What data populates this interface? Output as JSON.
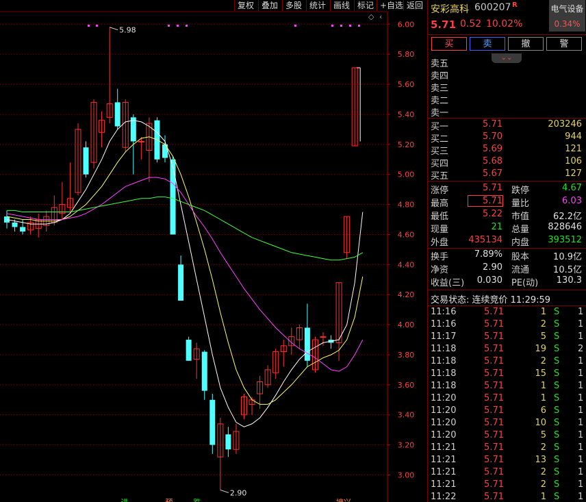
{
  "toolbar": {
    "items": [
      "复权",
      "叠加",
      "多股",
      "统计",
      "画线",
      "标记",
      "+自选",
      "返回"
    ]
  },
  "chart_data": {
    "type": "candlestick",
    "y_ticks": [
      "6.00",
      "5.80",
      "5.60",
      "5.40",
      "5.20",
      "5.00",
      "4.80",
      "4.60",
      "4.40",
      "4.20",
      "4.00",
      "3.80",
      "3.60",
      "3.40",
      "3.20",
      "3.00"
    ],
    "ylim": [
      2.95,
      6.03
    ],
    "high_label": "5.98",
    "low_label": "2.90",
    "bottom_markers": [
      "进",
      "预",
      "跌",
      "摘兴"
    ],
    "candles": [
      {
        "o": 4.72,
        "h": 4.76,
        "l": 4.64,
        "c": 4.68
      },
      {
        "o": 4.68,
        "h": 4.7,
        "l": 4.62,
        "c": 4.65
      },
      {
        "o": 4.65,
        "h": 4.7,
        "l": 4.6,
        "c": 4.62
      },
      {
        "o": 4.63,
        "h": 4.72,
        "l": 4.6,
        "c": 4.68
      },
      {
        "o": 4.64,
        "h": 4.74,
        "l": 4.58,
        "c": 4.7
      },
      {
        "o": 4.66,
        "h": 4.76,
        "l": 4.62,
        "c": 4.72
      },
      {
        "o": 4.68,
        "h": 4.86,
        "l": 4.66,
        "c": 4.78
      },
      {
        "o": 4.74,
        "h": 4.95,
        "l": 4.7,
        "c": 4.8
      },
      {
        "o": 4.78,
        "h": 5.08,
        "l": 4.74,
        "c": 4.84
      },
      {
        "o": 4.88,
        "h": 5.34,
        "l": 4.86,
        "c": 5.3
      },
      {
        "o": 5.18,
        "h": 5.22,
        "l": 4.98,
        "c": 5.0
      },
      {
        "o": 5.08,
        "h": 5.5,
        "l": 5.04,
        "c": 5.48
      },
      {
        "o": 5.28,
        "h": 5.42,
        "l": 5.18,
        "c": 5.36
      },
      {
        "o": 5.38,
        "h": 5.98,
        "l": 5.34,
        "c": 5.47
      },
      {
        "o": 5.48,
        "h": 5.57,
        "l": 5.3,
        "c": 5.32
      },
      {
        "o": 5.18,
        "h": 5.5,
        "l": 5.15,
        "c": 5.48
      },
      {
        "o": 5.38,
        "h": 5.4,
        "l": 5.0,
        "c": 5.22
      },
      {
        "o": 5.22,
        "h": 5.25,
        "l": 5.1,
        "c": 5.22
      },
      {
        "o": 5.16,
        "h": 5.38,
        "l": 4.95,
        "c": 5.34
      },
      {
        "o": 5.36,
        "h": 5.38,
        "l": 5.08,
        "c": 5.1
      },
      {
        "o": 5.2,
        "h": 5.26,
        "l": 5.08,
        "c": 5.11
      },
      {
        "o": 5.1,
        "h": 5.12,
        "l": 4.6,
        "c": 4.6
      },
      {
        "o": 4.4,
        "h": 4.46,
        "l": 4.16,
        "c": 4.16
      },
      {
        "o": 3.9,
        "h": 3.92,
        "l": 3.76,
        "c": 3.76
      },
      {
        "o": 3.77,
        "h": 3.88,
        "l": 3.64,
        "c": 3.84
      },
      {
        "o": 3.82,
        "h": 3.83,
        "l": 3.5,
        "c": 3.56
      },
      {
        "o": 3.5,
        "h": 3.54,
        "l": 3.14,
        "c": 3.2
      },
      {
        "o": 3.12,
        "h": 3.38,
        "l": 2.9,
        "c": 3.34
      },
      {
        "o": 3.27,
        "h": 3.32,
        "l": 3.12,
        "c": 3.17
      },
      {
        "o": 3.17,
        "h": 3.34,
        "l": 3.14,
        "c": 3.29
      },
      {
        "o": 3.4,
        "h": 3.54,
        "l": 3.37,
        "c": 3.52
      },
      {
        "o": 3.47,
        "h": 3.52,
        "l": 3.4,
        "c": 3.5
      },
      {
        "o": 3.54,
        "h": 3.66,
        "l": 3.44,
        "c": 3.62
      },
      {
        "o": 3.6,
        "h": 3.73,
        "l": 3.58,
        "c": 3.7
      },
      {
        "o": 3.68,
        "h": 3.84,
        "l": 3.64,
        "c": 3.82
      },
      {
        "o": 3.82,
        "h": 3.9,
        "l": 3.72,
        "c": 3.86
      },
      {
        "o": 3.86,
        "h": 3.98,
        "l": 3.8,
        "c": 3.92
      },
      {
        "o": 3.9,
        "h": 4.0,
        "l": 3.84,
        "c": 3.98
      },
      {
        "o": 3.98,
        "h": 4.14,
        "l": 3.72,
        "c": 3.76
      },
      {
        "o": 3.7,
        "h": 3.92,
        "l": 3.68,
        "c": 3.9
      },
      {
        "o": 3.92,
        "h": 3.95,
        "l": 3.86,
        "c": 3.92
      },
      {
        "o": 3.9,
        "h": 3.93,
        "l": 3.84,
        "c": 3.88
      },
      {
        "o": 3.88,
        "h": 4.28,
        "l": 3.76,
        "c": 4.28
      },
      {
        "o": 4.48,
        "h": 4.72,
        "l": 4.44,
        "c": 4.72
      },
      {
        "o": 5.19,
        "h": 5.71,
        "l": 5.19,
        "c": 5.71
      }
    ],
    "series": [
      {
        "color": "#ffffff",
        "values": [
          4.7,
          4.69,
          4.68,
          4.67,
          4.67,
          4.67,
          4.68,
          4.7,
          4.74,
          4.82,
          4.9,
          5.0,
          5.1,
          5.22,
          5.3,
          5.35,
          5.36,
          5.35,
          5.32,
          5.28,
          5.22,
          5.05,
          4.8,
          4.55,
          4.3,
          4.05,
          3.8,
          3.58,
          3.45,
          3.35,
          3.32,
          3.34,
          3.38,
          3.45,
          3.53,
          3.62,
          3.7,
          3.77,
          3.82,
          3.85,
          3.88,
          3.89,
          3.9,
          4.0,
          4.28,
          4.75
        ]
      },
      {
        "color": "#ffff60",
        "values": [
          4.72,
          4.71,
          4.7,
          4.7,
          4.69,
          4.69,
          4.69,
          4.7,
          4.72,
          4.76,
          4.8,
          4.86,
          4.92,
          5.0,
          5.08,
          5.15,
          5.2,
          5.24,
          5.25,
          5.23,
          5.2,
          5.12,
          5.0,
          4.85,
          4.68,
          4.5,
          4.3,
          4.08,
          3.88,
          3.7,
          3.58,
          3.5,
          3.47,
          3.47,
          3.5,
          3.55,
          3.6,
          3.66,
          3.72,
          3.75,
          3.78,
          3.8,
          3.83,
          3.9,
          4.05,
          4.32
        ]
      },
      {
        "color": "#ff40ff",
        "values": [
          4.74,
          4.73,
          4.72,
          4.71,
          4.7,
          4.7,
          4.7,
          4.7,
          4.71,
          4.72,
          4.74,
          4.77,
          4.8,
          4.84,
          4.88,
          4.92,
          4.94,
          4.96,
          4.98,
          4.98,
          4.97,
          4.94,
          4.88,
          4.8,
          4.72,
          4.65,
          4.57,
          4.48,
          4.4,
          4.32,
          4.24,
          4.17,
          4.1,
          4.04,
          3.98,
          3.93,
          3.88,
          3.84,
          3.81,
          3.78,
          3.74,
          3.7,
          3.69,
          3.72,
          3.8,
          3.9
        ]
      },
      {
        "color": "#40ff40",
        "values": [
          4.76,
          4.76,
          4.75,
          4.75,
          4.75,
          4.75,
          4.75,
          4.75,
          4.75,
          4.76,
          4.77,
          4.78,
          4.79,
          4.8,
          4.81,
          4.82,
          4.83,
          4.84,
          4.84,
          4.85,
          4.85,
          4.84,
          4.82,
          4.8,
          4.78,
          4.76,
          4.73,
          4.7,
          4.67,
          4.64,
          4.61,
          4.58,
          4.56,
          4.54,
          4.52,
          4.5,
          4.48,
          4.47,
          4.46,
          4.45,
          4.44,
          4.43,
          4.43,
          4.44,
          4.45,
          4.48
        ]
      }
    ]
  },
  "quote": {
    "name": "安彩高科",
    "code": "600207",
    "r_badge": "R",
    "sector": "电气设备",
    "sector_pct": "0.34%",
    "price": "5.71",
    "change": "0.52",
    "change_pct": "10.02%"
  },
  "buttons": {
    "buy": "买",
    "sell": "卖",
    "cancel": "撤",
    "alert": "警"
  },
  "asks": [
    {
      "label": "卖五",
      "price": "",
      "vol": ""
    },
    {
      "label": "卖四",
      "price": "",
      "vol": ""
    },
    {
      "label": "卖三",
      "price": "",
      "vol": ""
    },
    {
      "label": "卖二",
      "price": "",
      "vol": ""
    },
    {
      "label": "卖一",
      "price": "",
      "vol": ""
    }
  ],
  "bids": [
    {
      "label": "买一",
      "price": "5.71",
      "vol": "203246"
    },
    {
      "label": "买二",
      "price": "5.70",
      "vol": "944"
    },
    {
      "label": "买三",
      "price": "5.69",
      "vol": "121"
    },
    {
      "label": "买四",
      "price": "5.68",
      "vol": "106"
    },
    {
      "label": "买五",
      "price": "5.67",
      "vol": "127"
    }
  ],
  "stats": [
    {
      "l1": "涨停",
      "v1": "5.71",
      "c1": "red",
      "l2": "跌停",
      "v2": "4.67",
      "c2": "grn"
    },
    {
      "l1": "最高",
      "v1": "5.71",
      "c1": "red",
      "l2": "量比",
      "v2": "6.03",
      "c2": "mag"
    },
    {
      "l1": "最低",
      "v1": "5.22",
      "c1": "red",
      "l2": "市值",
      "v2": "62.2亿",
      "c2": "wht"
    },
    {
      "l1": "现量",
      "v1": "21",
      "c1": "grn",
      "l2": "总量",
      "v2": "828646",
      "c2": "wht"
    },
    {
      "l1": "外盘",
      "v1": "435134",
      "c1": "red",
      "l2": "内盘",
      "v2": "393512",
      "c2": "grn"
    }
  ],
  "stats2": [
    {
      "l1": "换手",
      "v1": "7.89%",
      "l2": "股本",
      "v2": "10.9亿"
    },
    {
      "l1": "净资",
      "v1": "2.90",
      "l2": "流通",
      "v2": "10.5亿"
    },
    {
      "l1": "收益(三)",
      "v1": "0.030",
      "l2": "PE(动)",
      "v2": "130.3"
    }
  ],
  "trade_status": "交易状态: 连续竞价 11:29:59",
  "ticks": [
    {
      "t": "11:16",
      "p": "5.71",
      "v": "1",
      "s": "S",
      "n": "1"
    },
    {
      "t": "11:16",
      "p": "5.71",
      "v": "2",
      "s": "S",
      "n": "1"
    },
    {
      "t": "11:17",
      "p": "5.71",
      "v": "5",
      "s": "S",
      "n": "1"
    },
    {
      "t": "11:18",
      "p": "5.71",
      "v": "19",
      "s": "S",
      "n": "2"
    },
    {
      "t": "11:18",
      "p": "5.71",
      "v": "2",
      "s": "S",
      "n": "1"
    },
    {
      "t": "11:18",
      "p": "5.71",
      "v": "15",
      "s": "S",
      "n": "1"
    },
    {
      "t": "11:18",
      "p": "5.71",
      "v": "1",
      "s": "S",
      "n": "1"
    },
    {
      "t": "11:20",
      "p": "5.71",
      "v": "1",
      "s": "S",
      "n": "1"
    },
    {
      "t": "11:20",
      "p": "5.71",
      "v": "6",
      "s": "S",
      "n": "1"
    },
    {
      "t": "11:20",
      "p": "5.71",
      "v": "10",
      "s": "S",
      "n": "1"
    },
    {
      "t": "11:20",
      "p": "5.71",
      "v": "5",
      "s": "S",
      "n": "1"
    },
    {
      "t": "11:21",
      "p": "5.71",
      "v": "2",
      "s": "S",
      "n": "1"
    },
    {
      "t": "11:21",
      "p": "5.71",
      "v": "13",
      "s": "S",
      "n": "1"
    },
    {
      "t": "11:21",
      "p": "5.71",
      "v": "2",
      "s": "S",
      "n": "1"
    },
    {
      "t": "11:21",
      "p": "5.71",
      "v": "2",
      "s": "S",
      "n": "1"
    },
    {
      "t": "11:22",
      "p": "5.71",
      "v": "1",
      "s": "S",
      "n": "1"
    }
  ]
}
